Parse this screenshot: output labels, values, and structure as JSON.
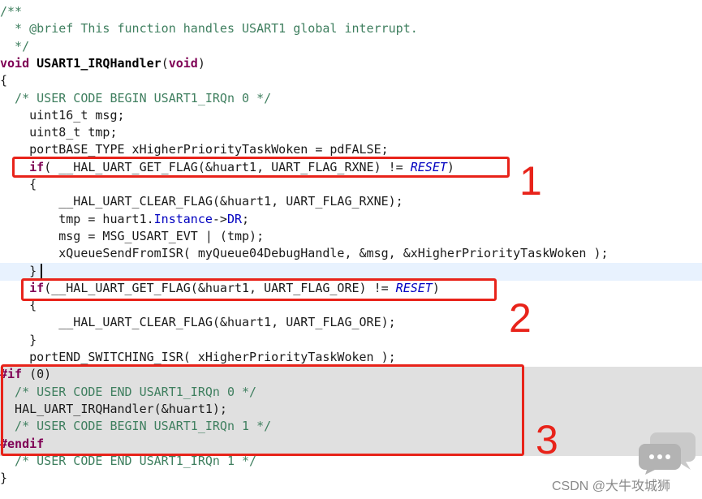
{
  "code_lines": [
    [
      {
        "t": "/**",
        "c": "comment"
      }
    ],
    [
      {
        "t": "  * @brief This function handles USART1 global interrupt.",
        "c": "comment"
      }
    ],
    [
      {
        "t": "  */",
        "c": "comment"
      }
    ],
    [
      {
        "t": "void",
        "c": "keyword"
      },
      {
        "t": " ",
        "c": "plain"
      },
      {
        "t": "USART1_IRQHandler",
        "c": "func"
      },
      {
        "t": "(",
        "c": "plain"
      },
      {
        "t": "void",
        "c": "keyword"
      },
      {
        "t": ")",
        "c": "plain"
      }
    ],
    [
      {
        "t": "{",
        "c": "plain"
      }
    ],
    [
      {
        "t": "  /* USER CODE BEGIN USART1_IRQn 0 */",
        "c": "comment"
      }
    ],
    [
      {
        "t": "    uint16_t msg;",
        "c": "plain"
      }
    ],
    [
      {
        "t": "    uint8_t tmp;",
        "c": "plain"
      }
    ],
    [
      {
        "t": "    portBASE_TYPE xHigherPriorityTaskWoken = pdFALSE;",
        "c": "plain"
      }
    ],
    [
      {
        "t": "    ",
        "c": "plain"
      },
      {
        "t": "if",
        "c": "keyword"
      },
      {
        "t": "( __HAL_UART_GET_FLAG(&huart1, UART_FLAG_RXNE) != ",
        "c": "plain"
      },
      {
        "t": "RESET",
        "c": "macro"
      },
      {
        "t": ")",
        "c": "plain"
      }
    ],
    [
      {
        "t": "    {",
        "c": "plain"
      }
    ],
    [
      {
        "t": "        __HAL_UART_CLEAR_FLAG(&huart1, UART_FLAG_RXNE);",
        "c": "plain"
      }
    ],
    [
      {
        "t": "        tmp = huart1.",
        "c": "plain"
      },
      {
        "t": "Instance",
        "c": "field"
      },
      {
        "t": "->",
        "c": "plain"
      },
      {
        "t": "DR",
        "c": "field"
      },
      {
        "t": ";",
        "c": "plain"
      }
    ],
    [
      {
        "t": "        msg = MSG_USART_EVT | (tmp);",
        "c": "plain"
      }
    ],
    [
      {
        "t": "        xQueueSendFromISR( myQueue04DebugHandle, &msg, &xHigherPriorityTaskWoken );",
        "c": "plain"
      }
    ],
    [
      {
        "t": "    }",
        "c": "plain"
      }
    ],
    [
      {
        "t": "    ",
        "c": "plain"
      },
      {
        "t": "if",
        "c": "keyword"
      },
      {
        "t": "(__HAL_UART_GET_FLAG(&huart1, UART_FLAG_ORE) != ",
        "c": "plain"
      },
      {
        "t": "RESET",
        "c": "macro"
      },
      {
        "t": ")",
        "c": "plain"
      }
    ],
    [
      {
        "t": "    {",
        "c": "plain"
      }
    ],
    [
      {
        "t": "        __HAL_UART_CLEAR_FLAG(&huart1, UART_FLAG_ORE);",
        "c": "plain"
      }
    ],
    [
      {
        "t": "    }",
        "c": "plain"
      }
    ],
    [
      {
        "t": "    portEND_SWITCHING_ISR( xHigherPriorityTaskWoken );",
        "c": "plain"
      }
    ],
    [
      {
        "t": "#if",
        "c": "preproc"
      },
      {
        "t": " (0)",
        "c": "plain"
      }
    ],
    [
      {
        "t": "  /* USER CODE END USART1_IRQn 0 */",
        "c": "comment"
      }
    ],
    [
      {
        "t": "  HAL_UART_IRQHandler(&huart1);",
        "c": "plain"
      }
    ],
    [
      {
        "t": "  /* USER CODE BEGIN USART1_IRQn 1 */",
        "c": "comment"
      }
    ],
    [
      {
        "t": "#endif",
        "c": "preproc"
      }
    ],
    [
      {
        "t": "  /* USER CODE END USART1_IRQn 1 */",
        "c": "comment"
      }
    ],
    [
      {
        "t": "}",
        "c": "plain"
      }
    ]
  ],
  "annotations": [
    {
      "label": "1",
      "color": "#e8231a"
    },
    {
      "label": "2",
      "color": "#e8231a"
    },
    {
      "label": "3",
      "color": "#e8231a"
    }
  ],
  "watermark": {
    "text": "CSDN @大牛攻城狮",
    "icon": "chat-bubbles-icon"
  },
  "colors": {
    "comment": "#3f7f5f",
    "keyword": "#7f0055",
    "macro": "#0000c0",
    "disabled_background": "#e0e0e0",
    "current_line_background": "#e8f2fe",
    "annotation_red": "#e8231a"
  }
}
